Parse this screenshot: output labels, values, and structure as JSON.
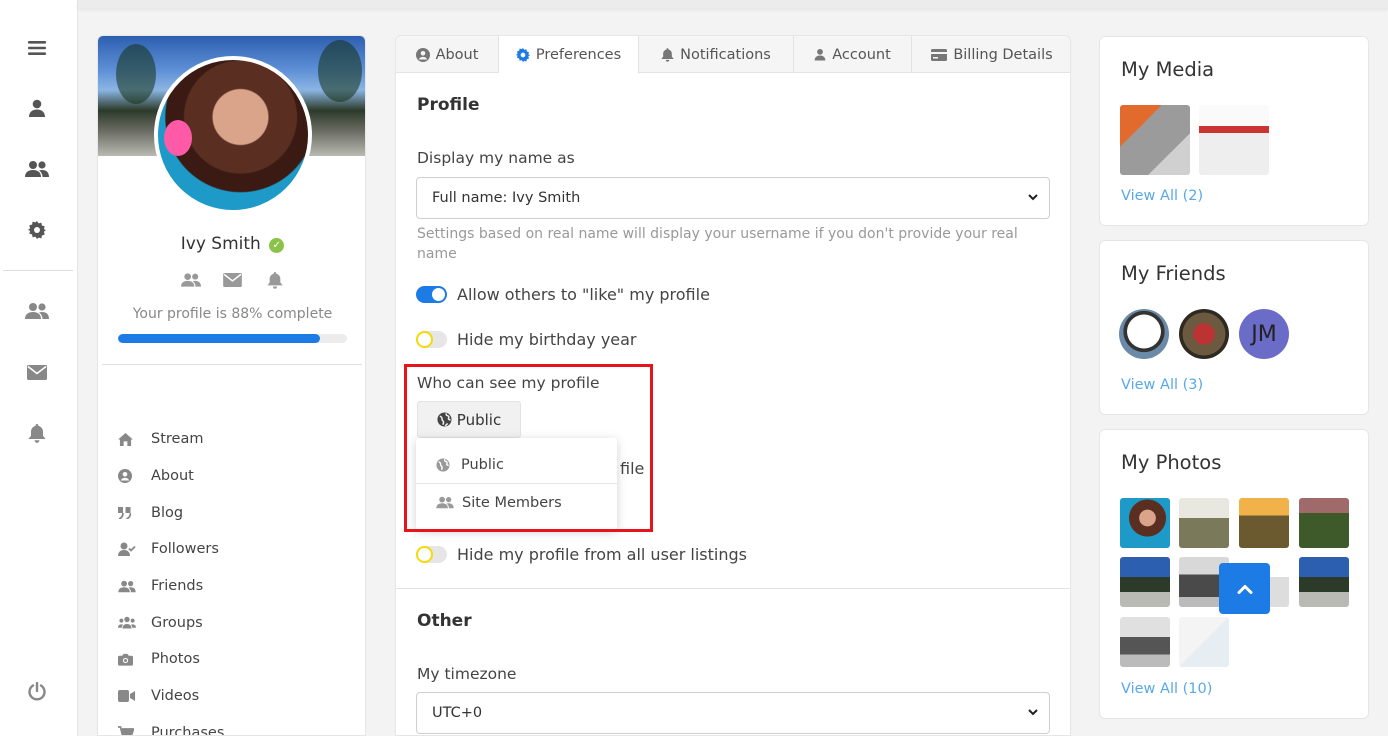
{
  "rail": {
    "icons": [
      "menu-icon",
      "user-icon",
      "users-icon",
      "gear-icon",
      "friends-icon",
      "envelope-icon",
      "bell-icon",
      "power-icon"
    ]
  },
  "profile": {
    "name": "Ivy Smith",
    "verified": true,
    "completion_text": "Your profile is 88% complete",
    "completion_percent": 88,
    "nav": [
      {
        "label": "Stream",
        "icon": "home-icon"
      },
      {
        "label": "About",
        "icon": "user-circle-icon"
      },
      {
        "label": "Blog",
        "icon": "quote-icon"
      },
      {
        "label": "Followers",
        "icon": "user-check-icon"
      },
      {
        "label": "Friends",
        "icon": "users-icon"
      },
      {
        "label": "Groups",
        "icon": "group-icon"
      },
      {
        "label": "Photos",
        "icon": "camera-icon"
      },
      {
        "label": "Videos",
        "icon": "video-icon"
      },
      {
        "label": "Purchases",
        "icon": "cart-icon"
      }
    ]
  },
  "tabs": [
    {
      "label": "About",
      "icon": "user-circle-icon",
      "active": false
    },
    {
      "label": "Preferences",
      "icon": "gear-icon",
      "active": true
    },
    {
      "label": "Notifications",
      "icon": "bell-icon",
      "active": false
    },
    {
      "label": "Account",
      "icon": "user-icon",
      "active": false
    },
    {
      "label": "Billing Details",
      "icon": "credit-card-icon",
      "active": false
    }
  ],
  "profile_section": {
    "title": "Profile",
    "display_name_label": "Display my name as",
    "display_name_value": "Full name: Ivy Smith",
    "display_name_hint": "Settings based on real name will display your username if you don't provide your real name",
    "allow_like_label": "Allow others to \"like\" my profile",
    "allow_like_on": true,
    "hide_birthday_label": "Hide my birthday year",
    "hide_birthday_on": false,
    "visibility_label": "Who can see my profile",
    "visibility_value": "Public",
    "visibility_options": [
      "Public",
      "Site Members"
    ],
    "partially_hidden_text": "file",
    "hide_listings_label": "Hide my profile from all user listings",
    "hide_listings_on": false
  },
  "other_section": {
    "title": "Other",
    "timezone_label": "My timezone",
    "timezone_value": "UTC+0"
  },
  "widgets": {
    "media": {
      "title": "My Media",
      "link": "View All (2)"
    },
    "friends": {
      "title": "My Friends",
      "link": "View All (3)",
      "initials": "JM"
    },
    "photos": {
      "title": "My Photos",
      "link": "View All (10)"
    }
  },
  "colors": {
    "accent": "#1d7be6",
    "link": "#5aa8e8",
    "highlight": "#e8141b",
    "verified": "#8bc34a",
    "toggle_off_ring": "#f5d90a"
  }
}
